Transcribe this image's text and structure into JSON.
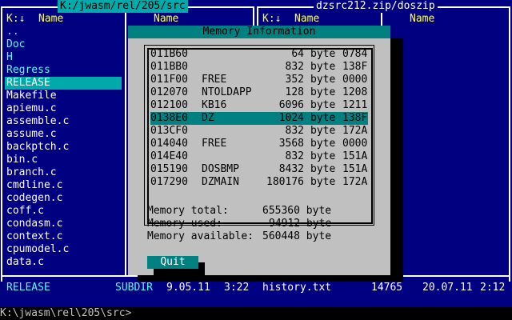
{
  "left_panel": {
    "path": "K:/jwasm/rel/205/src",
    "col_header_sort": "K:↓",
    "col_header_name1": "Name",
    "col_header_name2": "Name",
    "files": [
      {
        "name": "..",
        "type": "dir"
      },
      {
        "name": "Doc",
        "type": "dir"
      },
      {
        "name": "H",
        "type": "dir"
      },
      {
        "name": "Regress",
        "type": "dir"
      },
      {
        "name": "RELEASE",
        "type": "selected"
      },
      {
        "name": "Makefile",
        "type": "file"
      },
      {
        "name": "apiemu.c",
        "type": "file"
      },
      {
        "name": "assemble.c",
        "type": "file"
      },
      {
        "name": "assume.c",
        "type": "file"
      },
      {
        "name": "backptch.c",
        "type": "file"
      },
      {
        "name": "bin.c",
        "type": "file"
      },
      {
        "name": "branch.c",
        "type": "file"
      },
      {
        "name": "cmdline.c",
        "type": "file"
      },
      {
        "name": "codegen.c",
        "type": "file"
      },
      {
        "name": "coff.c",
        "type": "file"
      },
      {
        "name": "condasm.c",
        "type": "file"
      },
      {
        "name": "context.c",
        "type": "file"
      },
      {
        "name": "cpumodel.c",
        "type": "file"
      },
      {
        "name": "data.c",
        "type": "file"
      }
    ],
    "status_name": "RELEASE",
    "status_type": "SUBDIR",
    "status_date": "9.05.11",
    "status_time": "3:22"
  },
  "right_panel": {
    "path": "dzsrc212.zip/doszip",
    "col_header_sort": "K:↓",
    "col_header_name1": "Name",
    "col_header_name2": "Name",
    "status_name": "history.txt",
    "status_size": "14765",
    "status_date": "20.07.11",
    "status_time": "2:12"
  },
  "command_line": "K:\\jwasm\\rel\\205\\src>",
  "dialog": {
    "title": "Memory Information",
    "rows": [
      {
        "addr": "011B60",
        "name": "",
        "size": "64",
        "unit": "byte",
        "owner": "0784"
      },
      {
        "addr": "011BB0",
        "name": "",
        "size": "832",
        "unit": "byte",
        "owner": "138F"
      },
      {
        "addr": "011F00",
        "name": "FREE",
        "size": "352",
        "unit": "byte",
        "owner": "0000"
      },
      {
        "addr": "012070",
        "name": "NTOLDAPP",
        "size": "128",
        "unit": "byte",
        "owner": "1208"
      },
      {
        "addr": "012100",
        "name": "KB16",
        "size": "6096",
        "unit": "byte",
        "owner": "1211"
      },
      {
        "addr": "0138E0",
        "name": "DZ",
        "size": "1024",
        "unit": "byte",
        "owner": "138F",
        "selected": true
      },
      {
        "addr": "013CF0",
        "name": "",
        "size": "832",
        "unit": "byte",
        "owner": "172A"
      },
      {
        "addr": "014040",
        "name": "FREE",
        "size": "3568",
        "unit": "byte",
        "owner": "0000"
      },
      {
        "addr": "014E40",
        "name": "",
        "size": "832",
        "unit": "byte",
        "owner": "151A"
      },
      {
        "addr": "015190",
        "name": "DOSBMP",
        "size": "8432",
        "unit": "byte",
        "owner": "151A"
      },
      {
        "addr": "017290",
        "name": "DZMAIN",
        "size": "180176",
        "unit": "byte",
        "owner": "172A"
      }
    ],
    "total_label": "Memory total:",
    "total_value": "655360 byte",
    "used_label": "Memory used:",
    "used_value": "94912 byte",
    "avail_label": "Memory available:",
    "avail_value": "560448 byte",
    "quit_label": "Quit"
  },
  "colors": {
    "background": "#000080",
    "dialog": "#c0c0c0",
    "accent": "#008080",
    "header": "#ffff55",
    "dir": "#55ffff"
  }
}
